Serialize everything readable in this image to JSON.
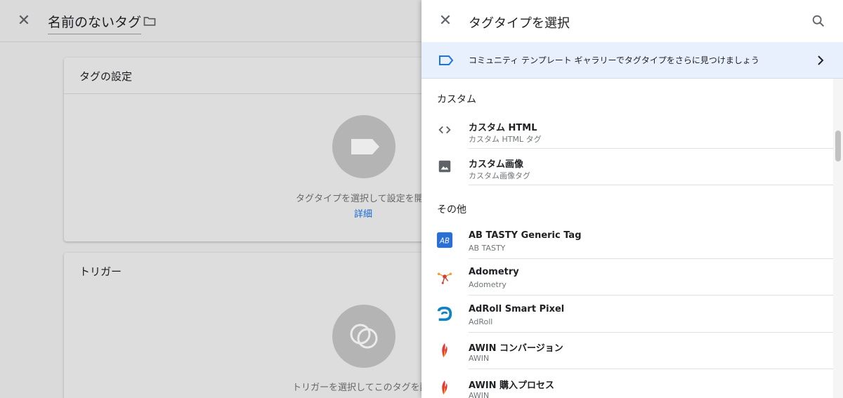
{
  "background_editor": {
    "title": "名前のないタグ",
    "tag_config_card": {
      "heading": "タグの設定",
      "prompt": "タグタイプを選択して設定を開始",
      "link": "詳細"
    },
    "trigger_card": {
      "heading": "トリガー",
      "prompt": "トリガーを選択してこのタグを配信"
    }
  },
  "panel": {
    "title": "タグタイプを選択",
    "banner_text": "コミュニティ テンプレート ギャラリーでタグタイプをさらに見つけましょう",
    "sections": [
      {
        "label": "カスタム",
        "items": [
          {
            "name": "カスタム HTML",
            "sub": "カスタム HTML タグ",
            "icon": "code-icon"
          },
          {
            "name": "カスタム画像",
            "sub": "カスタム画像タグ",
            "icon": "image-icon"
          }
        ]
      },
      {
        "label": "その他",
        "items": [
          {
            "name": "AB TASTY Generic Tag",
            "sub": "AB TASTY",
            "icon": "ab-tasty-logo-icon"
          },
          {
            "name": "Adometry",
            "sub": "Adometry",
            "icon": "adometry-logo-icon"
          },
          {
            "name": "AdRoll Smart Pixel",
            "sub": "AdRoll",
            "icon": "adroll-logo-icon"
          },
          {
            "name": "AWIN コンバージョン",
            "sub": "AWIN",
            "icon": "awin-logo-icon"
          },
          {
            "name": "AWIN 購入プロセス",
            "sub": "AWIN",
            "icon": "awin-logo-icon"
          }
        ]
      }
    ]
  },
  "colors": {
    "accent": "#1a73e8",
    "banner_bg": "#e8f0fe",
    "awin_red": "#e53935",
    "adroll_blue": "#0a84c6"
  }
}
